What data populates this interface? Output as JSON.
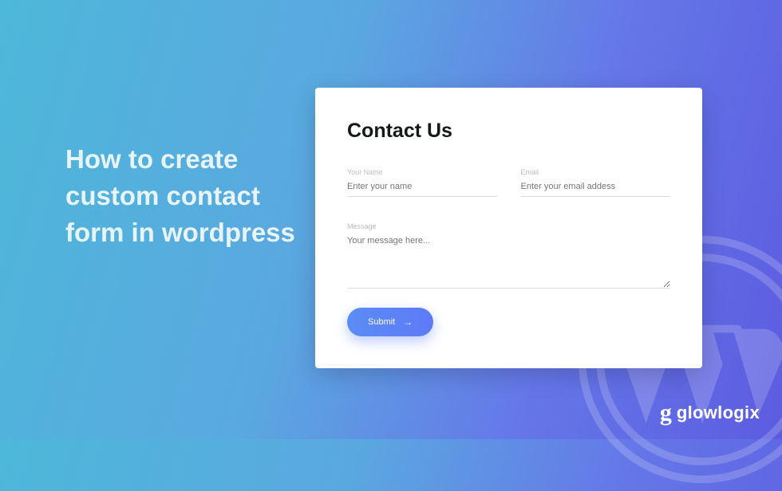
{
  "headline": "How to create custom contact form in wordpress",
  "form": {
    "title": "Contact Us",
    "name": {
      "label": "Your Name",
      "placeholder": "Enter your name"
    },
    "email": {
      "label": "Email",
      "placeholder": "Enter your email addess"
    },
    "message": {
      "label": "Message",
      "placeholder": "Your message here..."
    },
    "submit": "Submit"
  },
  "brand": {
    "text": "glowlogix"
  },
  "colors": {
    "accent": "#5d7af7"
  }
}
